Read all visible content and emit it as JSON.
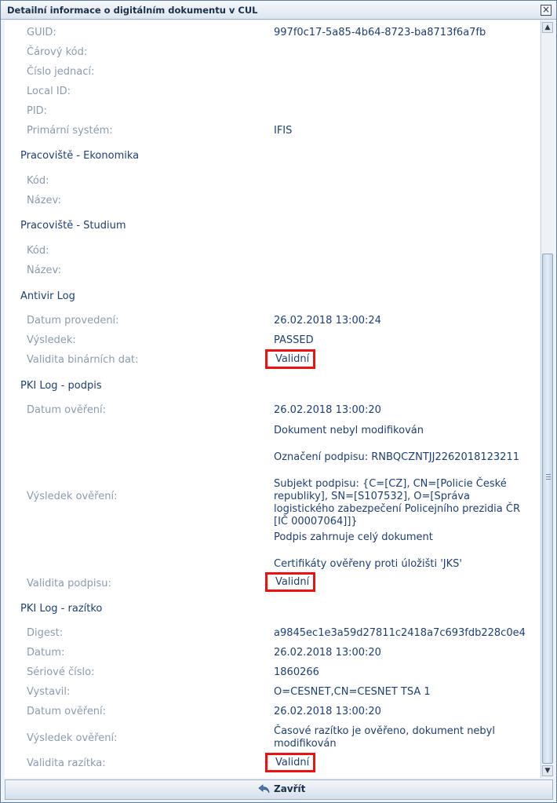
{
  "window": {
    "title": "Detailní informace o digitálním dokumentu v CUL"
  },
  "general": {
    "rows": [
      {
        "label": "GUID:",
        "value": "997f0c17-5a85-4b64-8723-ba8713f6a7fb"
      },
      {
        "label": "Čárový kód:",
        "value": ""
      },
      {
        "label": "Číslo jednací:",
        "value": ""
      },
      {
        "label": "Local ID:",
        "value": ""
      },
      {
        "label": "PID:",
        "value": ""
      },
      {
        "label": "Primární systém:",
        "value": "IFIS"
      }
    ]
  },
  "ekonomika": {
    "title": "Pracoviště - Ekonomika",
    "rows": [
      {
        "label": "Kód:"
      },
      {
        "label": "Název:"
      }
    ]
  },
  "studium": {
    "title": "Pracoviště - Studium",
    "rows": [
      {
        "label": "Kód:"
      },
      {
        "label": "Název:"
      }
    ]
  },
  "antivir": {
    "title": "Antivir Log",
    "date_label": "Datum provedení:",
    "date_value": "26.02.2018 13:00:24",
    "result_label": "Výsledek:",
    "result_value": "PASSED",
    "validity_label": "Validita binárních dat:",
    "validity_value": "Validní"
  },
  "pki_sign": {
    "title": "PKI Log - podpis",
    "date_label": "Datum ověření:",
    "date_value": "26.02.2018 13:00:20",
    "result_label": "Výsledek ověření:",
    "result_lines": [
      "Dokument nebyl modifikován",
      "Označení podpisu: RNBQCZNTJJ2262018123211",
      "Subjekt podpisu: {C=[CZ], CN=[Policie České republiky], SN=[S107532], O=[Správa logistického zabezpečení Policejního prezidia ČR [IČ 00007064]]}",
      "Podpis zahrnuje celý dokument",
      "Certifikáty ověřeny proti úložišti 'JKS'"
    ],
    "validity_label": "Validita podpisu:",
    "validity_value": "Validní"
  },
  "pki_stamp": {
    "title": "PKI Log - razítko",
    "digest_label": "Digest:",
    "digest_value": "a9845ec1e3a59d27811c2418a7c693fdb228c0e4",
    "date_label": "Datum:",
    "date_value": "26.02.2018 13:00:20",
    "serial_label": "Sériové číslo:",
    "serial_value": "1860266",
    "issuer_label": "Vystavil:",
    "issuer_value": "O=CESNET,CN=CESNET TSA 1",
    "verified_label": "Datum ověření:",
    "verified_value": "26.02.2018 13:00:20",
    "result_label": "Výsledek ověření:",
    "result_value": "Časové razítko je ověřeno, dokument nebyl modifikován",
    "validity_label": "Validita razítka:",
    "validity_value": "Validní"
  },
  "footer": {
    "close_label": "Zavřít"
  },
  "colors": {
    "highlight": "#ee1111",
    "value_text": "#1c3f73",
    "label_text": "#8a9bb0"
  }
}
